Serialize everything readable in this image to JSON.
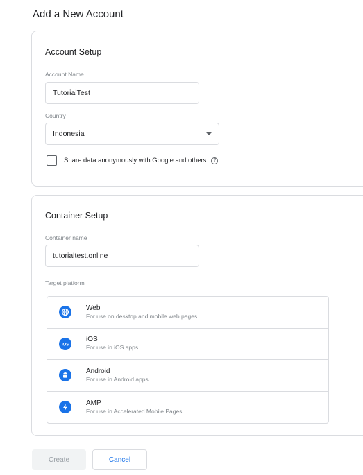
{
  "page_title": "Add a New Account",
  "account_setup": {
    "title": "Account Setup",
    "account_name_label": "Account Name",
    "account_name_value": "TutorialTest",
    "country_label": "Country",
    "country_value": "Indonesia",
    "share_label": "Share data anonymously with Google and others",
    "share_checked": false
  },
  "container_setup": {
    "title": "Container Setup",
    "container_name_label": "Container name",
    "container_name_value": "tutorialtest.online",
    "target_platform_label": "Target platform",
    "platforms": [
      {
        "name": "Web",
        "desc": "For use on desktop and mobile web pages",
        "icon": "globe-icon"
      },
      {
        "name": "iOS",
        "desc": "For use in iOS apps",
        "icon": "ios-icon"
      },
      {
        "name": "Android",
        "desc": "For use in Android apps",
        "icon": "android-icon"
      },
      {
        "name": "AMP",
        "desc": "For use in Accelerated Mobile Pages",
        "icon": "amp-lightning-icon"
      }
    ]
  },
  "buttons": {
    "create": "Create",
    "cancel": "Cancel"
  },
  "colors": {
    "accent": "#1a73e8",
    "border": "#dadce0",
    "muted_text": "#80868b"
  }
}
